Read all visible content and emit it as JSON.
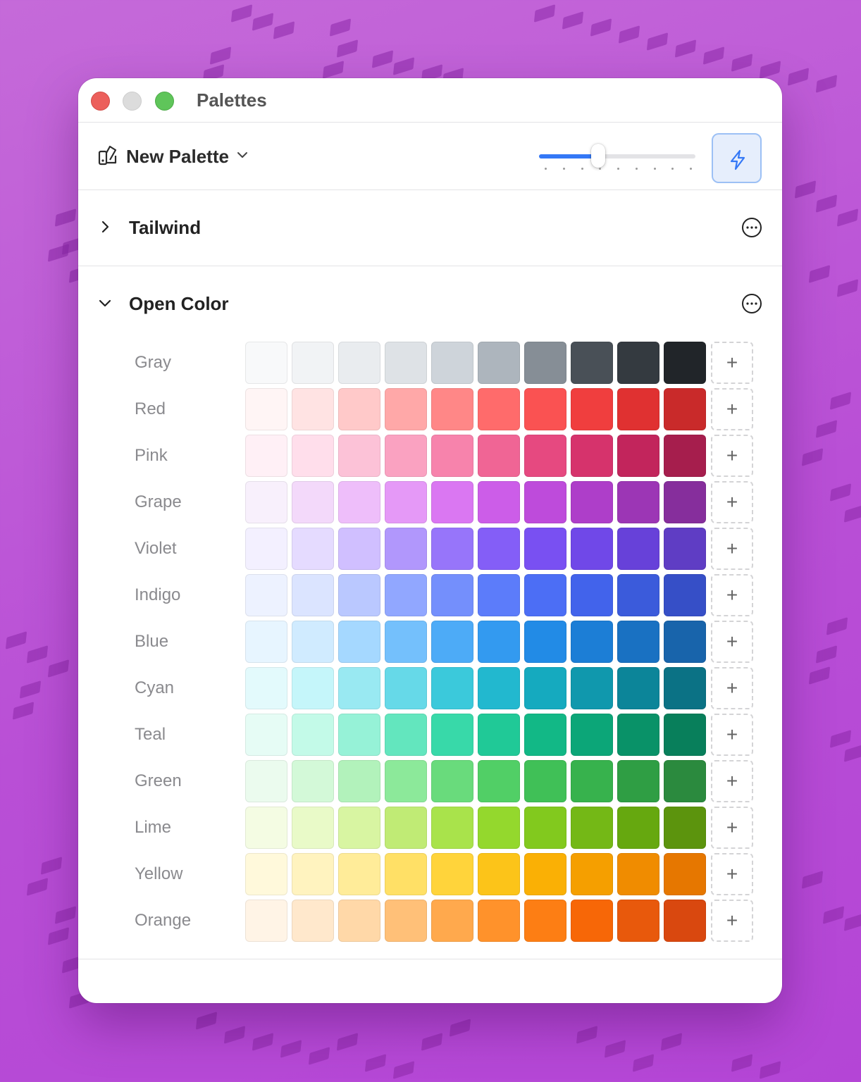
{
  "window": {
    "title": "Palettes"
  },
  "toolbar": {
    "palette_name": "New Palette",
    "slider_value": 0.38,
    "slider_ticks": 9
  },
  "sections": [
    {
      "name": "Tailwind",
      "expanded": false
    },
    {
      "name": "Open Color",
      "expanded": true
    }
  ],
  "add_label": "+",
  "palette": {
    "rows": [
      {
        "name": "Gray",
        "colors": [
          "#f8f9fa",
          "#f1f3f5",
          "#e9ecef",
          "#dee2e6",
          "#ced4da",
          "#adb5bd",
          "#868e96",
          "#495057",
          "#343a40",
          "#212529"
        ]
      },
      {
        "name": "Red",
        "colors": [
          "#fff5f5",
          "#ffe3e3",
          "#ffc9c9",
          "#ffa8a8",
          "#ff8787",
          "#ff6b6b",
          "#fa5252",
          "#f03e3e",
          "#e03131",
          "#c92a2a"
        ]
      },
      {
        "name": "Pink",
        "colors": [
          "#fff0f6",
          "#ffdeeb",
          "#fcc2d7",
          "#faa2c1",
          "#f783ac",
          "#f06595",
          "#e64980",
          "#d6336c",
          "#c2255c",
          "#a61e4d"
        ]
      },
      {
        "name": "Grape",
        "colors": [
          "#f8f0fc",
          "#f3d9fa",
          "#eebefa",
          "#e599f7",
          "#da77f2",
          "#cc5de8",
          "#be4bdb",
          "#ae3ec9",
          "#9c36b5",
          "#862e9c"
        ]
      },
      {
        "name": "Violet",
        "colors": [
          "#f3f0ff",
          "#e5dbff",
          "#d0bfff",
          "#b197fc",
          "#9775fa",
          "#845ef7",
          "#7950f2",
          "#7048e8",
          "#6741d9",
          "#5f3dc4"
        ]
      },
      {
        "name": "Indigo",
        "colors": [
          "#edf2ff",
          "#dbe4ff",
          "#bac8ff",
          "#91a7ff",
          "#748ffc",
          "#5c7cfa",
          "#4c6ef5",
          "#4263eb",
          "#3b5bdb",
          "#364fc7"
        ]
      },
      {
        "name": "Blue",
        "colors": [
          "#e7f5ff",
          "#d0ebff",
          "#a5d8ff",
          "#74c0fc",
          "#4dabf7",
          "#339af0",
          "#228be6",
          "#1c7ed6",
          "#1971c2",
          "#1864ab"
        ]
      },
      {
        "name": "Cyan",
        "colors": [
          "#e3fafc",
          "#c5f6fa",
          "#99e9f2",
          "#66d9e8",
          "#3bc9db",
          "#22b8cf",
          "#15aabf",
          "#1098ad",
          "#0c8599",
          "#0b7285"
        ]
      },
      {
        "name": "Teal",
        "colors": [
          "#e6fcf5",
          "#c3fae8",
          "#96f2d7",
          "#63e6be",
          "#38d9a9",
          "#20c997",
          "#12b886",
          "#0ca678",
          "#099268",
          "#087f5b"
        ]
      },
      {
        "name": "Green",
        "colors": [
          "#ebfbee",
          "#d3f9d8",
          "#b2f2bb",
          "#8ce99a",
          "#69db7c",
          "#51cf66",
          "#40c057",
          "#37b24d",
          "#2f9e44",
          "#2b8a3e"
        ]
      },
      {
        "name": "Lime",
        "colors": [
          "#f4fce3",
          "#e9fac8",
          "#d8f5a2",
          "#c0eb75",
          "#a9e34b",
          "#94d82d",
          "#82c91e",
          "#74b816",
          "#66a80f",
          "#5c940d"
        ]
      },
      {
        "name": "Yellow",
        "colors": [
          "#fff9db",
          "#fff3bf",
          "#ffec99",
          "#ffe066",
          "#ffd43b",
          "#fcc419",
          "#fab005",
          "#f59f00",
          "#f08c00",
          "#e67700"
        ]
      },
      {
        "name": "Orange",
        "colors": [
          "#fff4e6",
          "#ffe8cc",
          "#ffd8a8",
          "#ffc078",
          "#ffa94d",
          "#ff922b",
          "#fd7e14",
          "#f76707",
          "#e8590c",
          "#d9480f"
        ]
      }
    ]
  },
  "colors": {
    "accent": "#3478f6",
    "bolt": "#3478f6"
  },
  "icons": {
    "palette": "palette-icon",
    "bolt": "bolt-icon",
    "more": "more-circle-icon"
  }
}
